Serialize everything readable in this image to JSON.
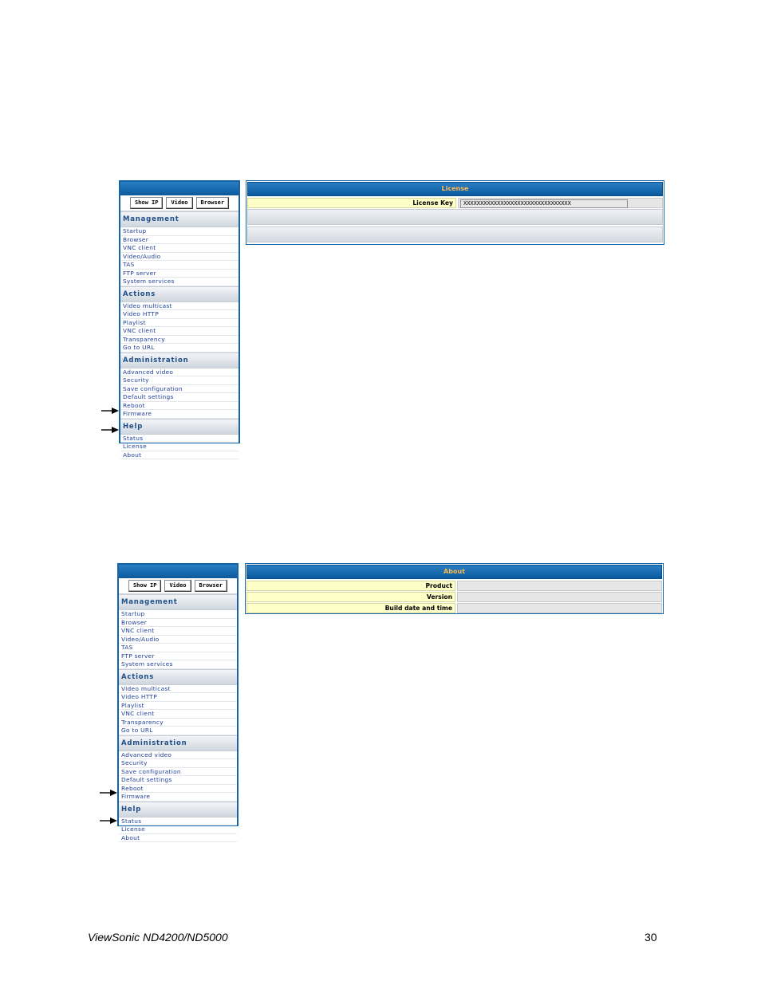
{
  "screens": [
    {
      "sidebar": {
        "buttons": [
          "Show IP",
          "Video",
          "Browser"
        ],
        "sections": [
          {
            "title": "Management",
            "items": [
              "Startup",
              "Browser",
              "VNC client",
              "Video/Audio",
              "TAS",
              "FTP server",
              "System services"
            ]
          },
          {
            "title": "Actions",
            "items": [
              "Video multicast",
              "Video HTTP",
              "Playlist",
              "VNC client",
              "Transparency",
              "Go to URL"
            ]
          },
          {
            "title": "Administration",
            "items": [
              "Advanced video",
              "Security",
              "Save configuration",
              "Default settings",
              "Reboot",
              "Firmware"
            ]
          },
          {
            "title": "Help",
            "items": [
              "Status",
              "License",
              "About"
            ]
          }
        ]
      },
      "panel": {
        "title": "License",
        "license_key_label": "License Key",
        "license_key_value": "XXXXXXXXXXXXXXXXXXXXXXXXXXXXXXXX"
      }
    },
    {
      "sidebar": {
        "buttons": [
          "Show IP",
          "Video",
          "Browser"
        ],
        "sections": [
          {
            "title": "Management",
            "items": [
              "Startup",
              "Browser",
              "VNC client",
              "Video/Audio",
              "TAS",
              "FTP server",
              "System services"
            ]
          },
          {
            "title": "Actions",
            "items": [
              "Video multicast",
              "Video HTTP",
              "Playlist",
              "VNC client",
              "Transparency",
              "Go to URL"
            ]
          },
          {
            "title": "Administration",
            "items": [
              "Advanced video",
              "Security",
              "Save configuration",
              "Default settings",
              "Reboot",
              "Firmware"
            ]
          },
          {
            "title": "Help",
            "items": [
              "Status",
              "License",
              "About"
            ]
          }
        ]
      },
      "panel": {
        "title": "About",
        "rows": [
          "Product",
          "Version",
          "Build date and time"
        ]
      }
    }
  ],
  "footer": {
    "product": "ViewSonic ND4200/ND5000",
    "page_number": "30"
  },
  "colors": {
    "header_blue": "#1565a8",
    "title_orange": "#ffb94a",
    "label_yellow": "#ffffc8",
    "link_blue": "#1f3f9a"
  }
}
